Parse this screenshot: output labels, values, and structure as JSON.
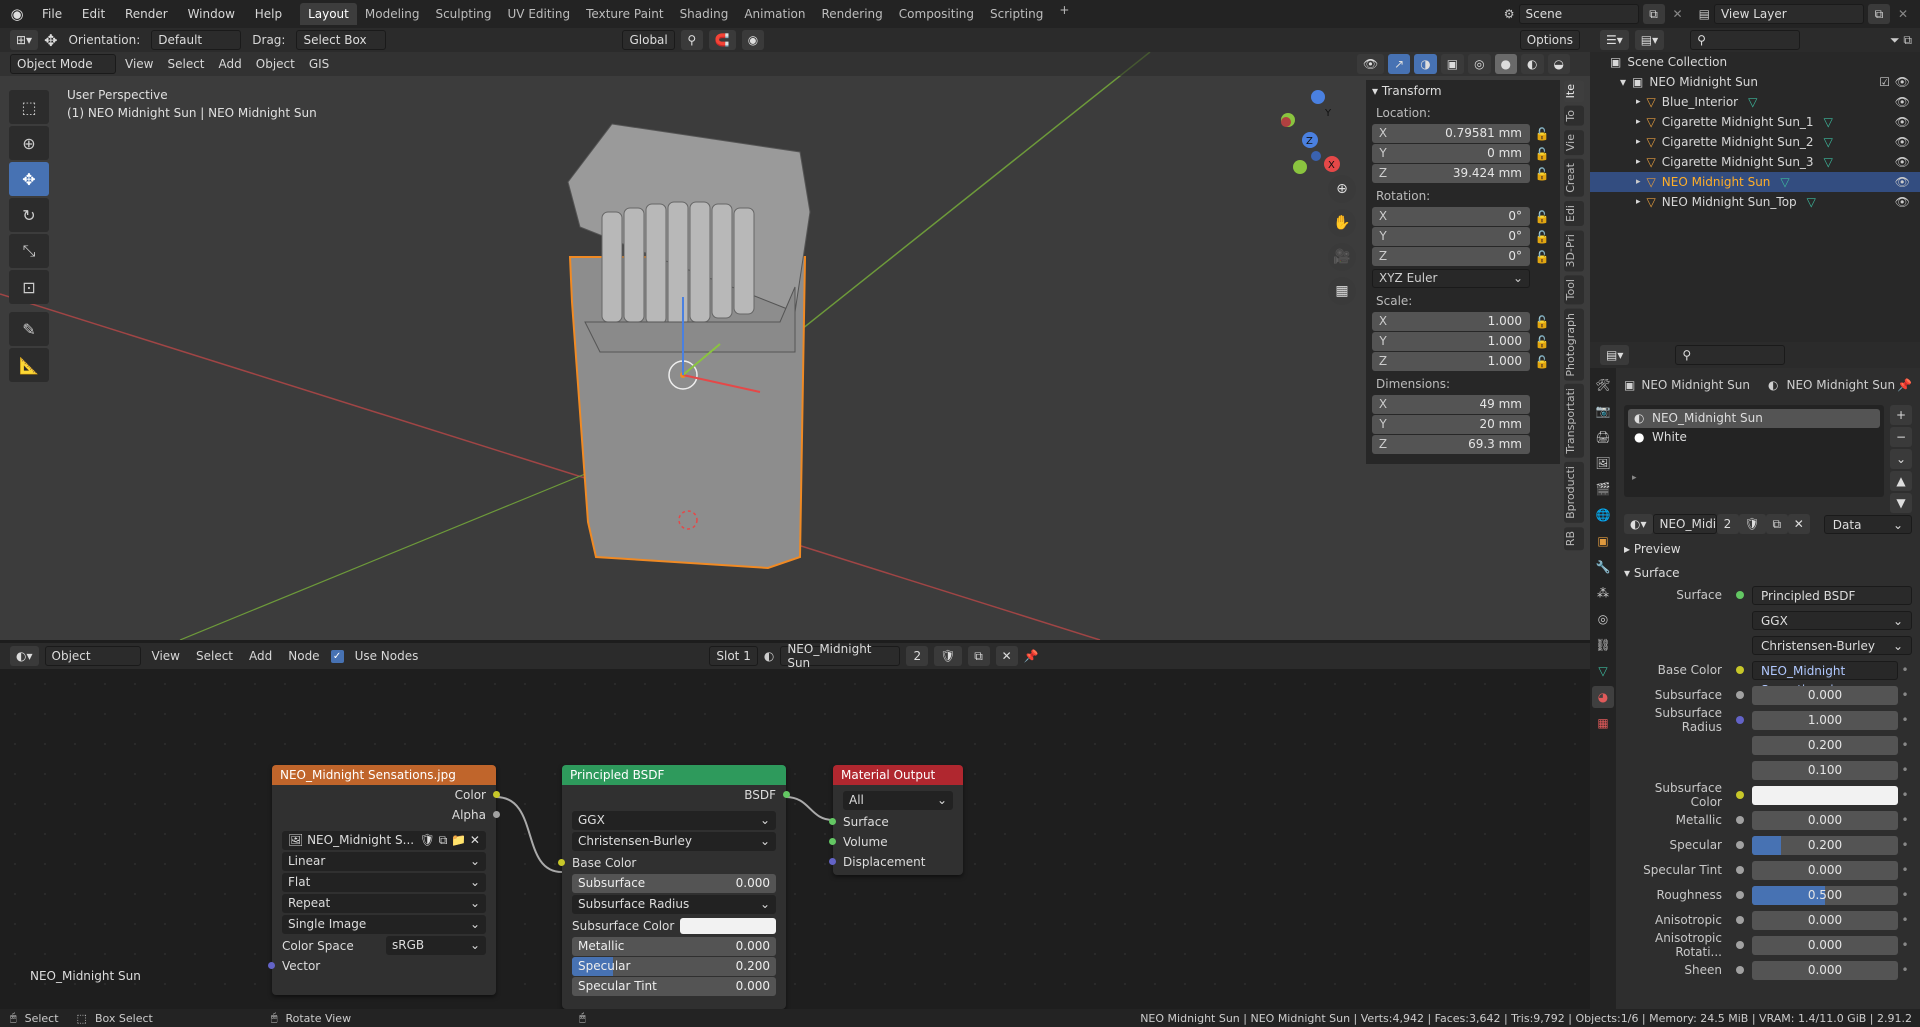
{
  "menubar": {
    "items": [
      "File",
      "Edit",
      "Render",
      "Window",
      "Help"
    ],
    "workspaces": [
      "Layout",
      "Modeling",
      "Sculpting",
      "UV Editing",
      "Texture Paint",
      "Shading",
      "Animation",
      "Rendering",
      "Compositing",
      "Scripting"
    ],
    "active_workspace": "Layout",
    "scene": "Scene",
    "view_layer": "View Layer"
  },
  "viewport_header": {
    "orientation_label": "Orientation:",
    "orientation_value": "Default",
    "drag_label": "Drag:",
    "drag_value": "Select Box",
    "transform_space": "Global",
    "options": "Options",
    "mode": "Object Mode",
    "menus": [
      "View",
      "Select",
      "Add",
      "Object",
      "GIS"
    ]
  },
  "viewport": {
    "perspective": "User Perspective",
    "object_info": "(1) NEO Midnight Sun | NEO Midnight Sun",
    "gizmo_axes": {
      "x": "X",
      "y": "Y",
      "z": "Z"
    }
  },
  "npanel": {
    "title": "Transform",
    "location_label": "Location:",
    "location": [
      {
        "axis": "X",
        "value": "0.79581 mm"
      },
      {
        "axis": "Y",
        "value": "0 mm"
      },
      {
        "axis": "Z",
        "value": "39.424 mm"
      }
    ],
    "rotation_label": "Rotation:",
    "rotation": [
      {
        "axis": "X",
        "value": "0°"
      },
      {
        "axis": "Y",
        "value": "0°"
      },
      {
        "axis": "Z",
        "value": "0°"
      }
    ],
    "rotation_mode": "XYZ Euler",
    "scale_label": "Scale:",
    "scale": [
      {
        "axis": "X",
        "value": "1.000"
      },
      {
        "axis": "Y",
        "value": "1.000"
      },
      {
        "axis": "Z",
        "value": "1.000"
      }
    ],
    "dimensions_label": "Dimensions:",
    "dimensions": [
      {
        "axis": "X",
        "value": "49 mm"
      },
      {
        "axis": "Y",
        "value": "20 mm"
      },
      {
        "axis": "Z",
        "value": "69.3 mm"
      }
    ],
    "tabs": [
      "Ite",
      "To",
      "Vie",
      "Creat",
      "Edi",
      "3D-Pri",
      "Tool",
      "Photograph",
      "Transportati",
      "Bproducti",
      "RB"
    ]
  },
  "node_header": {
    "mode": "Object",
    "menus": [
      "View",
      "Select",
      "Add",
      "Node"
    ],
    "use_nodes": "Use Nodes",
    "slot": "Slot 1",
    "material": "NEO_Midnight Sun",
    "users": "2"
  },
  "nodes": {
    "image": {
      "title": "NEO_Midnight Sensations.jpg",
      "out_color": "Color",
      "out_alpha": "Alpha",
      "image_name": "NEO_Midnight S...",
      "interpolation": "Linear",
      "projection": "Flat",
      "extension": "Repeat",
      "source": "Single Image",
      "color_space_label": "Color Space",
      "color_space": "sRGB",
      "in_vector": "Vector"
    },
    "bsdf": {
      "title": "Principled BSDF",
      "out": "BSDF",
      "distribution": "GGX",
      "subsurface_method": "Christensen-Burley",
      "base_color": "Base Color",
      "subsurface_label": "Subsurface",
      "subsurface": "0.000",
      "subsurface_radius": "Subsurface Radius",
      "subsurface_color": "Subsurface Color",
      "metallic_label": "Metallic",
      "metallic": "0.000",
      "specular_label": "Specular",
      "specular": "0.200",
      "specular_tint_label": "Specular Tint",
      "specular_tint": "0.000"
    },
    "output": {
      "title": "Material Output",
      "target": "All",
      "surface": "Surface",
      "volume": "Volume",
      "displacement": "Displacement"
    },
    "editor_label": "NEO_Midnight Sun"
  },
  "outliner": {
    "root": "Scene Collection",
    "collection": "NEO Midnight Sun",
    "items": [
      "Blue_Interior",
      "Cigarette Midnight Sun_1",
      "Cigarette Midnight Sun_2",
      "Cigarette Midnight Sun_3",
      "NEO Midnight Sun",
      "NEO Midnight Sun_Top"
    ],
    "selected": "NEO Midnight Sun"
  },
  "properties": {
    "object_name": "NEO Midnight Sun",
    "material_name": "NEO Midnight Sun",
    "slots": [
      "NEO_Midnight Sun",
      "White"
    ],
    "material_field": "NEO_Midi...",
    "users": "2",
    "link": "Data",
    "preview": "Preview",
    "surface_section": "Surface",
    "surface_label": "Surface",
    "surface_value": "Principled BSDF",
    "distribution": "GGX",
    "subsurface_method": "Christensen-Burley",
    "rows": [
      {
        "label": "Base Color",
        "value": "NEO_Midnight Sensations.j...",
        "kind": "link"
      },
      {
        "label": "Subsurface",
        "value": "0.000",
        "kind": "num",
        "fill": 0
      },
      {
        "label": "Subsurface Radius",
        "value": "1.000",
        "kind": "num",
        "fill": 0
      },
      {
        "label": "",
        "value": "0.200",
        "kind": "num",
        "fill": 0
      },
      {
        "label": "",
        "value": "0.100",
        "kind": "num",
        "fill": 0
      },
      {
        "label": "Subsurface Color",
        "value": "",
        "kind": "color"
      },
      {
        "label": "Metallic",
        "value": "0.000",
        "kind": "num",
        "fill": 0
      },
      {
        "label": "Specular",
        "value": "0.200",
        "kind": "num",
        "fill": 0.2
      },
      {
        "label": "Specular Tint",
        "value": "0.000",
        "kind": "num",
        "fill": 0
      },
      {
        "label": "Roughness",
        "value": "0.500",
        "kind": "num",
        "fill": 0.5
      },
      {
        "label": "Anisotropic",
        "value": "0.000",
        "kind": "num",
        "fill": 0
      },
      {
        "label": "Anisotropic Rotati...",
        "value": "0.000",
        "kind": "num",
        "fill": 0
      },
      {
        "label": "Sheen",
        "value": "0.000",
        "kind": "num",
        "fill": 0
      }
    ]
  },
  "statusbar": {
    "select": "Select",
    "box_select": "Box Select",
    "rotate_view": "Rotate View",
    "stats": "NEO Midnight Sun | NEO Midnight Sun | Verts:4,942 | Faces:3,642 | Tris:9,792 | Objects:1/6 | Memory: 24.5 MiB | VRAM: 1.4/11.0 GiB | 2.91.2"
  },
  "colors": {
    "accent": "#4772b3",
    "selected_text": "#ffaf29",
    "header_orange": "#c0652b",
    "header_green": "#2e9a5c",
    "header_red": "#b0272f"
  }
}
